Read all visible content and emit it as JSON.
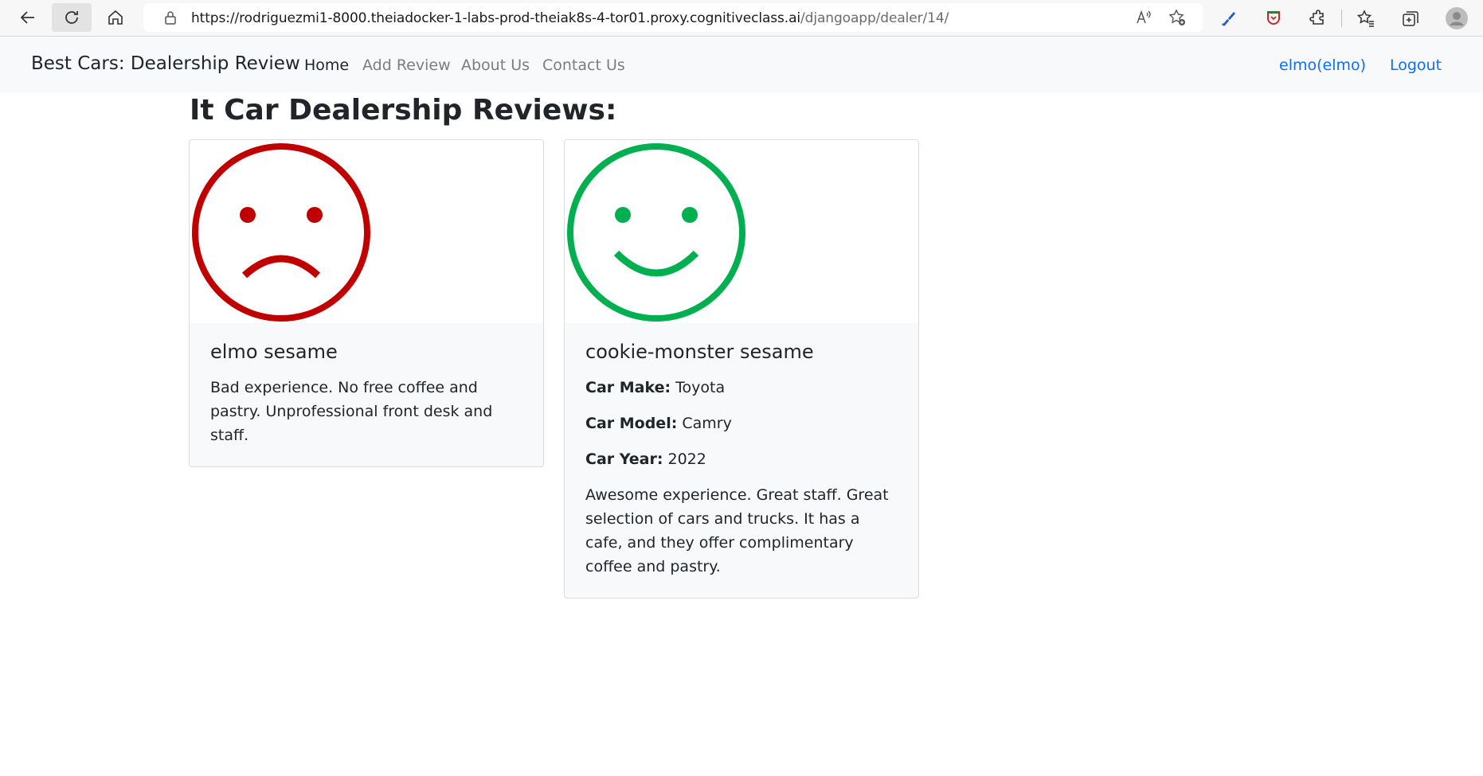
{
  "browser": {
    "url_host": "https://rodriguezmi1-8000.theiadocker-1-labs-prod-theiak8s-4-tor01.proxy.cognitiveclass.ai",
    "url_path": "/djangoapp/dealer/14/"
  },
  "navbar": {
    "brand": "Best Cars: Dealership Review",
    "links": [
      {
        "label": "Home"
      },
      {
        "label": "Add Review"
      },
      {
        "label": "About Us"
      },
      {
        "label": "Contact Us"
      }
    ],
    "user": "elmo(elmo)",
    "logout": "Logout"
  },
  "page": {
    "title": "It Car Dealership Reviews:"
  },
  "reviews": [
    {
      "name": "elmo sesame",
      "sentiment": "negative",
      "icon": "sad-face-icon",
      "color": "#c00000",
      "text": "Bad experience. No free coffee and pastry. Unprofessional front desk and staff."
    },
    {
      "name": "cookie-monster sesame",
      "sentiment": "positive",
      "icon": "happy-face-icon",
      "color": "#00b050",
      "car_make_label": "Car Make:",
      "car_make": "Toyota",
      "car_model_label": "Car Model:",
      "car_model": "Camry",
      "car_year_label": "Car Year:",
      "car_year": "2022",
      "text": "Awesome experience. Great staff. Great selection of cars and trucks. It has a cafe, and they offer complimentary coffee and pastry."
    }
  ]
}
